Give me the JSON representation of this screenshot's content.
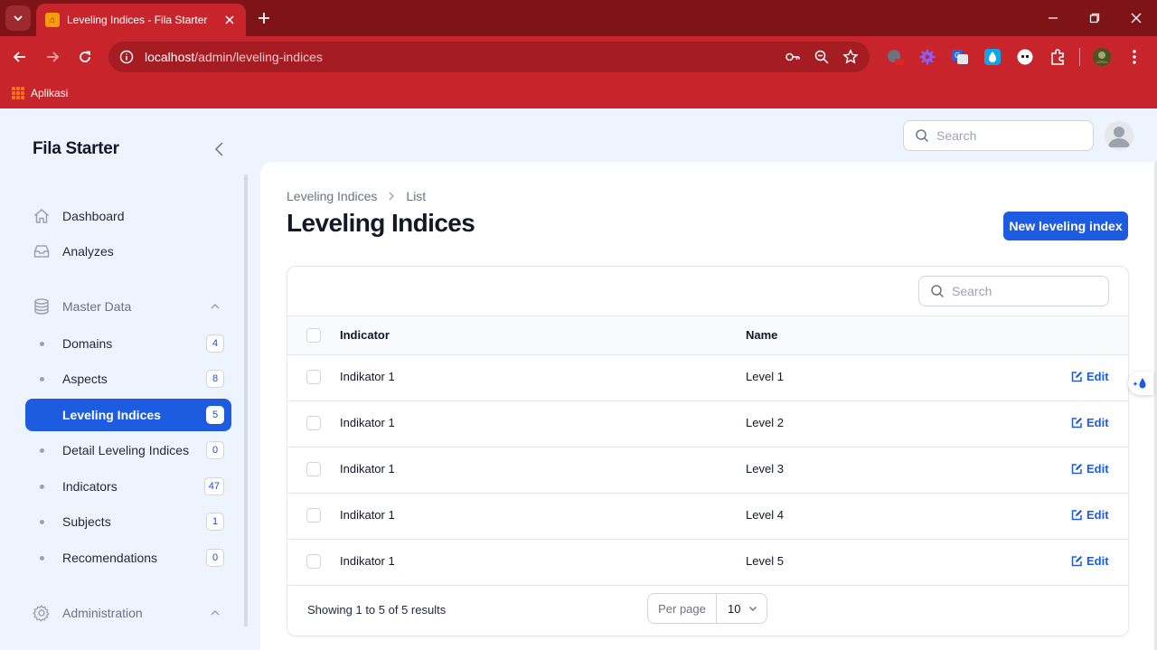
{
  "browser": {
    "tab_title": "Leveling Indices - Fila Starter",
    "url_host": "localhost",
    "url_path": "/admin/leveling-indices",
    "bookmark_label": "Aplikasi"
  },
  "app": {
    "brand": "Fila Starter",
    "top_search_placeholder": "Search"
  },
  "sidebar": {
    "items": [
      {
        "label": "Dashboard",
        "icon": "home-icon"
      },
      {
        "label": "Analyzes",
        "icon": "inbox-icon"
      }
    ],
    "groups": [
      {
        "label": "Master Data",
        "icon": "database-icon",
        "items": [
          {
            "label": "Domains",
            "badge": "4"
          },
          {
            "label": "Aspects",
            "badge": "8"
          },
          {
            "label": "Leveling Indices",
            "badge": "5",
            "active": true
          },
          {
            "label": "Detail Leveling Indices",
            "badge": "0"
          },
          {
            "label": "Indicators",
            "badge": "47"
          },
          {
            "label": "Subjects",
            "badge": "1"
          },
          {
            "label": "Recomendations",
            "badge": "0"
          }
        ]
      },
      {
        "label": "Administration",
        "icon": "cog-icon"
      }
    ]
  },
  "main": {
    "breadcrumb": [
      "Leveling Indices",
      "List"
    ],
    "title": "Leveling Indices",
    "new_button": "New leveling index",
    "table_search_placeholder": "Search",
    "columns": [
      "Indicator",
      "Name"
    ],
    "rows": [
      {
        "indicator": "Indikator 1",
        "name": "Level 1",
        "action": "Edit"
      },
      {
        "indicator": "Indikator 1",
        "name": "Level 2",
        "action": "Edit"
      },
      {
        "indicator": "Indikator 1",
        "name": "Level 3",
        "action": "Edit"
      },
      {
        "indicator": "Indikator 1",
        "name": "Level 4",
        "action": "Edit"
      },
      {
        "indicator": "Indikator 1",
        "name": "Level 5",
        "action": "Edit"
      }
    ],
    "footer": {
      "showing": "Showing 1 to 5 of 5 results",
      "per_page_label": "Per page",
      "per_page_value": "10"
    }
  },
  "colors": {
    "chrome_dark": "#7f1418",
    "chrome": "#c8242b",
    "primary": "#1d5ce0",
    "app_bg": "#eef4fd"
  }
}
